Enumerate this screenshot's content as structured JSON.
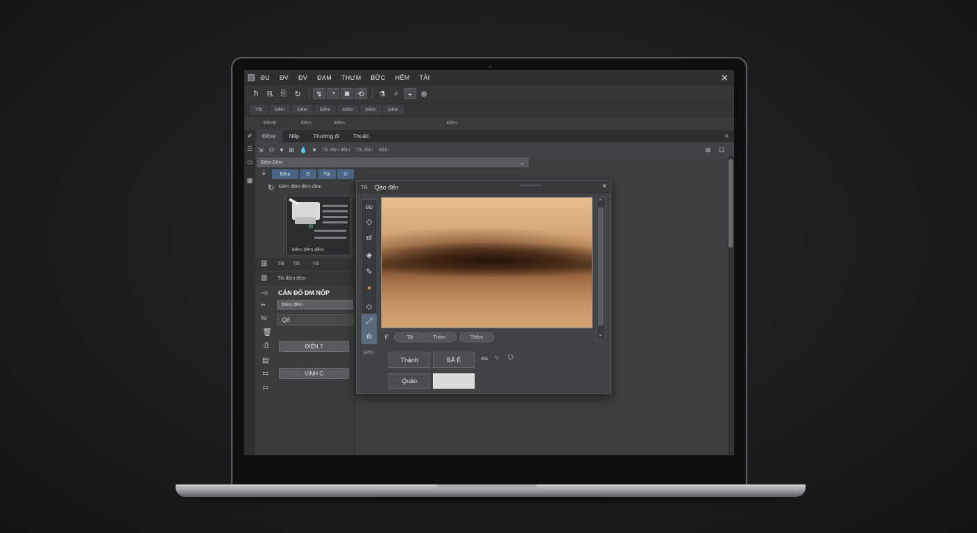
{
  "window": {
    "menu": [
      "ƏU",
      "ĐV",
      "ĐV",
      "ĐAM",
      "THƯM",
      "BỮC",
      "HẾM",
      "TẢI"
    ],
    "close": "✕"
  },
  "toolbar": {
    "icons": [
      "ħ",
      "ℝ",
      "⎘",
      "↻",
      "↯",
      "◔",
      "◙",
      "⟲",
      "⚗",
      "⌕",
      "◒",
      "⊕"
    ]
  },
  "tab_strip": {
    "tabs": [
      "Tôi",
      "Đêm",
      "Đêm",
      "Đêm",
      "Đêm",
      "Đêm",
      "Đêm"
    ]
  },
  "sub_strip": {
    "items": [
      "Đêvêr",
      "Đêm",
      "Đêm",
      "Đêm ⊖",
      "Đêm"
    ]
  },
  "document": {
    "tabs": [
      "Đêve",
      "Nếp",
      "Thường đi",
      "Thuậtt"
    ],
    "close": "×"
  },
  "options": {
    "items": [
      "⇲",
      "⚇",
      "▾",
      "⊞",
      "💧",
      "▾"
    ],
    "small_text": [
      "Tôi đêm đêm",
      "Tôi đêm",
      "Đêm"
    ],
    "right_icons": [
      "⊞",
      "☐"
    ],
    "dropdown": "Đêm Đêm"
  },
  "side_panel": {
    "blue_tabs": [
      "Đêm",
      "Đ",
      "Tôi",
      "⊙"
    ],
    "layer_title": "Đêm đêm đêm đêm",
    "thumb_caption": "Đêm đêm đêm",
    "row1": [
      "Tôi",
      "Tôi",
      "Tôi"
    ],
    "row2": "Tôi đêm đêm",
    "section_title": "CẢN ĐÔ ĐM NỘP",
    "field1": "Đêm đêm",
    "field2": "Qỏ",
    "button1": "ĐIỆN 7",
    "button2": "VỊNH C"
  },
  "dialog": {
    "title_left": "Tôi",
    "title": "Qảo đến",
    "tools": [
      "ĐĐ",
      "◇",
      "ĐĨ",
      "◈",
      "✎",
      "●",
      "◇",
      "⤢",
      "ılı"
    ],
    "pills": [
      "Tôi",
      "Thôm",
      "Thêm"
    ],
    "bottom_label": "Đêm",
    "buttons": {
      "button1": "Thánh",
      "button2": "BẢ Ê",
      "button3": "Quảo",
      "extra_label": "Đa"
    }
  }
}
